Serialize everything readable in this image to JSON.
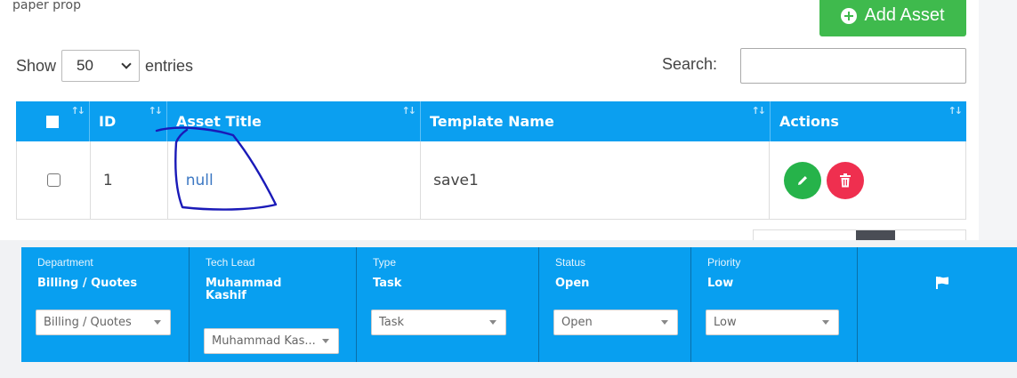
{
  "top_caption": "paper prop",
  "toolbar": {
    "add_asset_label": "Add Asset"
  },
  "table_controls": {
    "show_label": "Show",
    "page_length": "50",
    "entries_label": "entries",
    "search_label": "Search:",
    "search_value": ""
  },
  "table": {
    "columns": [
      "ID",
      "Asset Title",
      "Template Name",
      "Actions"
    ],
    "rows": [
      {
        "id": "1",
        "asset_title": "null",
        "template_name": "save1"
      }
    ]
  },
  "ticket_bar": {
    "department": {
      "label": "Department",
      "value": "Billing / Quotes",
      "selected": "Billing / Quotes"
    },
    "tech_lead": {
      "label": "Tech Lead",
      "value": "Muhammad Kashif",
      "selected": "Muhammad Kas..."
    },
    "type": {
      "label": "Type",
      "value": "Task",
      "selected": "Task"
    },
    "status": {
      "label": "Status",
      "value": "Open",
      "selected": "Open"
    },
    "priority": {
      "label": "Priority",
      "value": "Low",
      "selected": "Low"
    }
  },
  "colors": {
    "header_blue": "#0b9ff0",
    "success_green": "#3fba4d",
    "danger_red": "#ef2f4f",
    "annotation_ink": "#1a1ab8"
  },
  "icons": [
    "plus-circle-icon",
    "chevron-down-icon",
    "sort-icon",
    "pencil-icon",
    "trash-icon",
    "flag-icon"
  ]
}
